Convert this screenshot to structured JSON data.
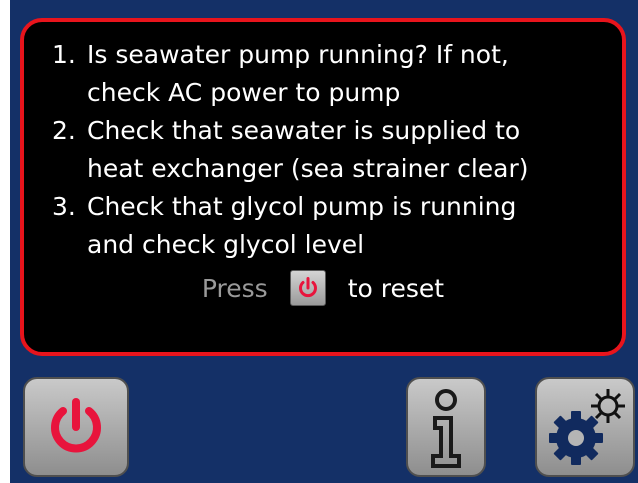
{
  "alert": {
    "steps": [
      {
        "num": "1.",
        "text": "Is seawater pump running? If not,\ncheck AC power to pump"
      },
      {
        "num": "2.",
        "text": "Check that seawater is supplied to\nheat exchanger (sea strainer clear)"
      },
      {
        "num": "3.",
        "text": "Check that glycol pump is running\nand check glycol level"
      }
    ],
    "reset": {
      "press_label": "Press",
      "button_icon": "power-icon",
      "to_reset_label": "to reset"
    }
  },
  "toolbar": {
    "power_icon": "power-icon",
    "info_icon": "info-icon",
    "settings_icon": "gears-icon"
  },
  "colors": {
    "background": "#143067",
    "alert_border": "#e8141c",
    "power_icon": "#e8143c",
    "button_gray": "#b0b0b0"
  }
}
